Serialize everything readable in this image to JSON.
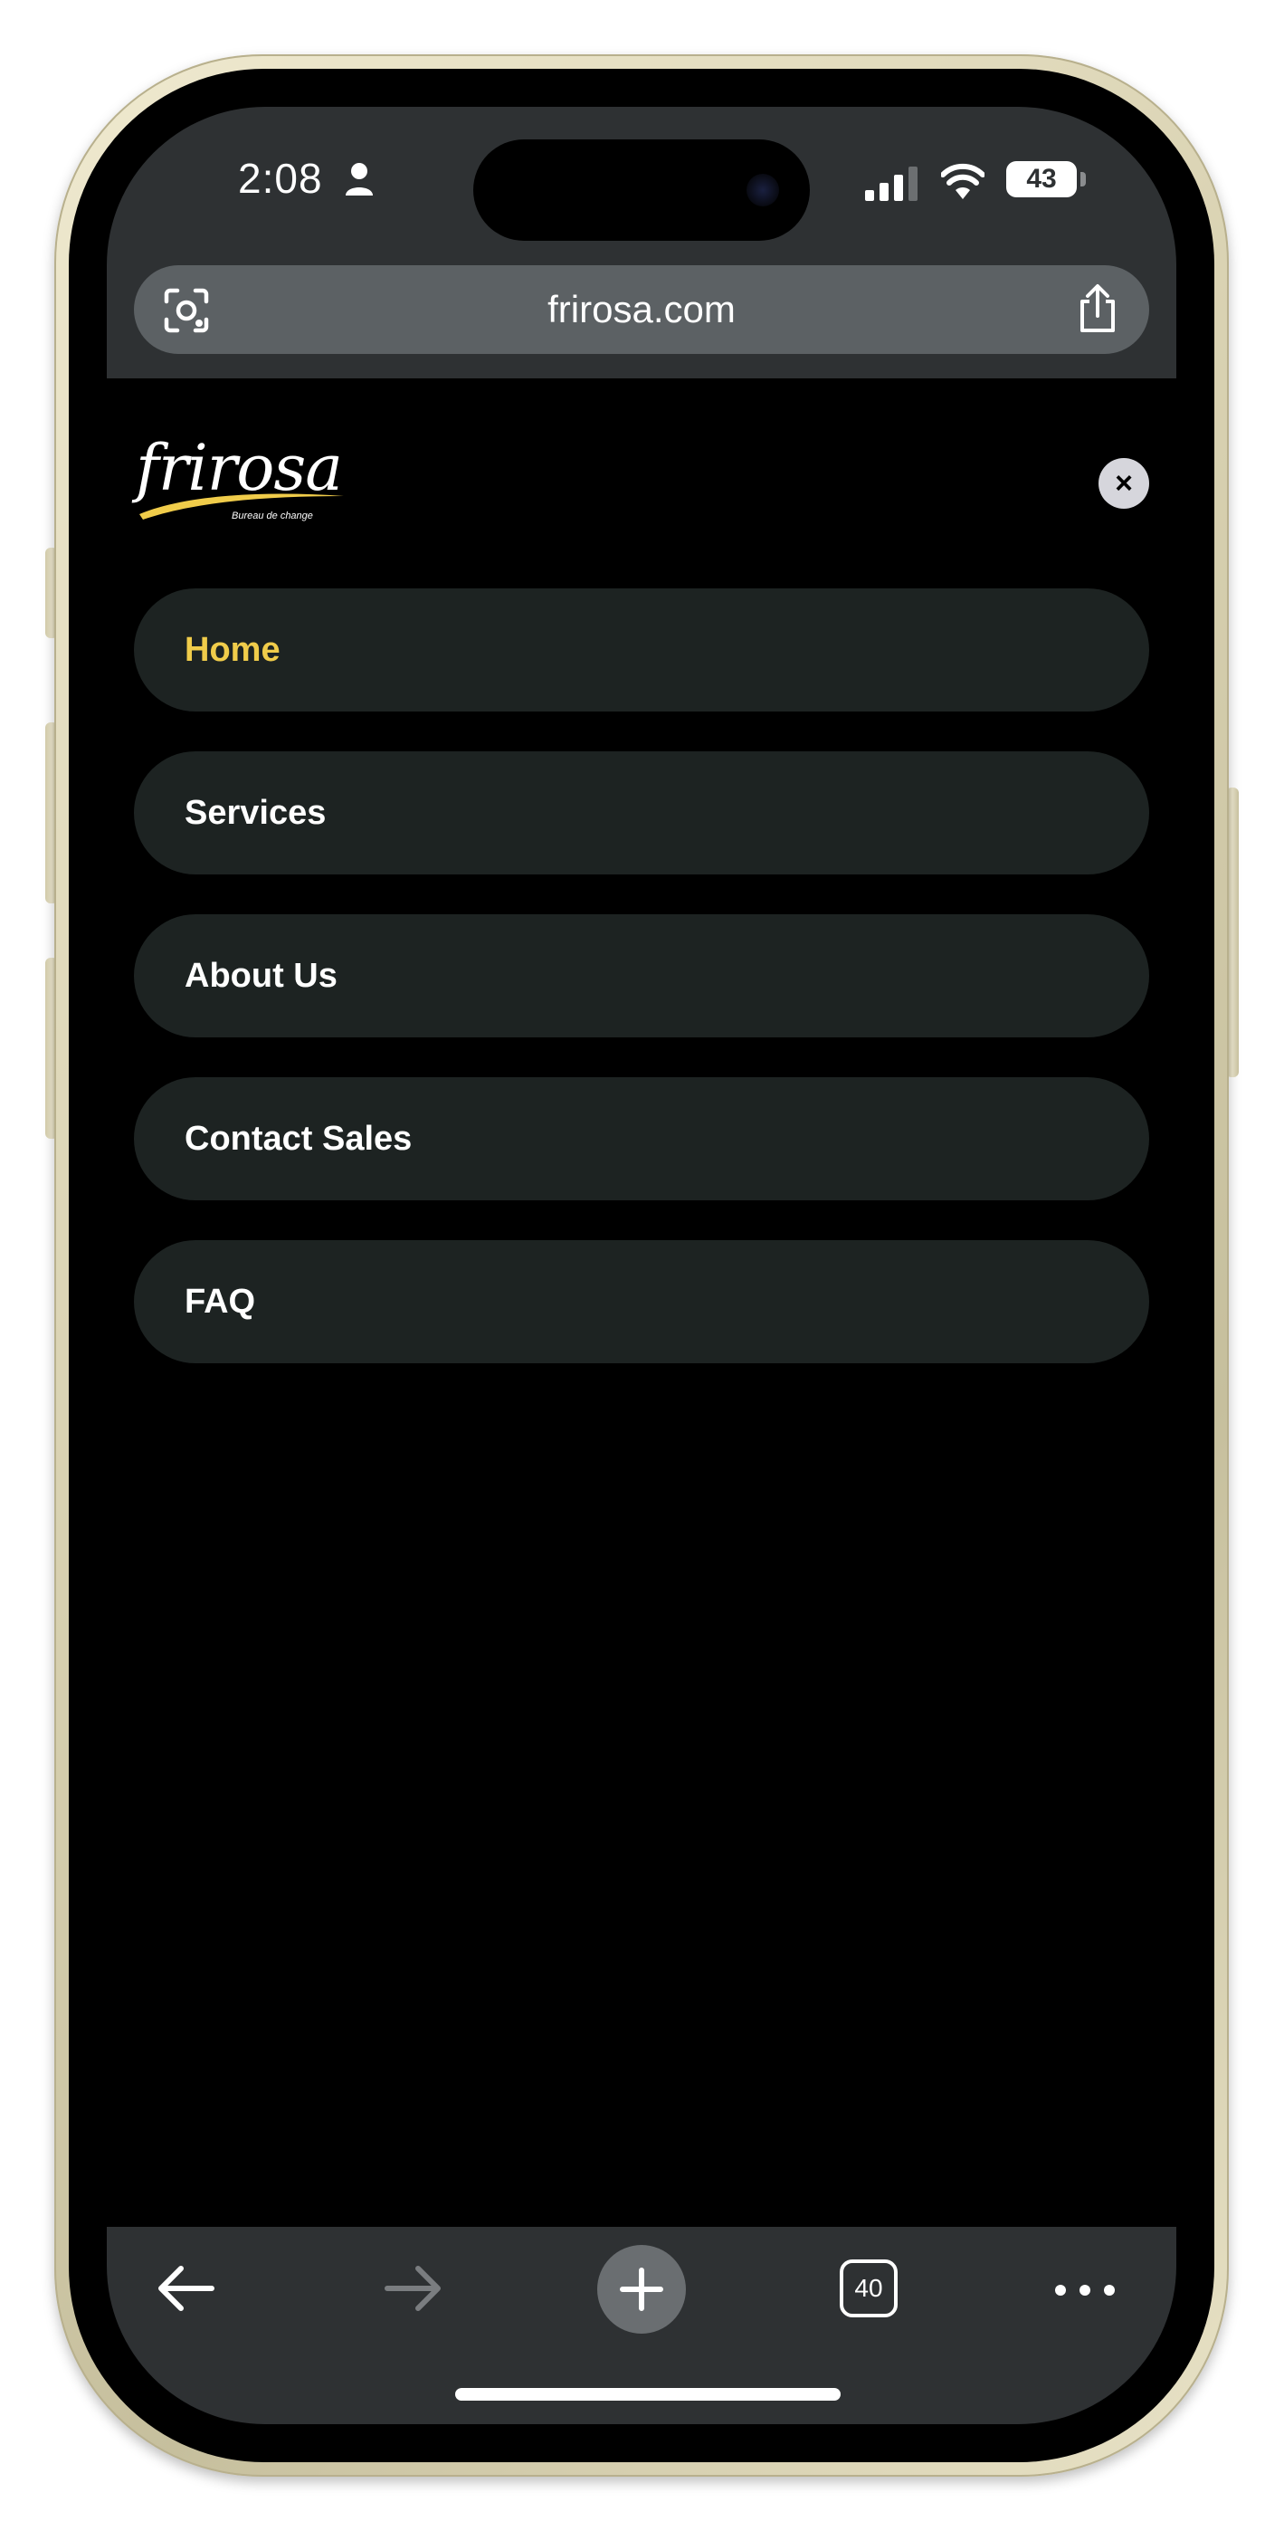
{
  "status_bar": {
    "time": "2:08",
    "battery": "43"
  },
  "browser": {
    "url": "frirosa.com",
    "tab_count": "40"
  },
  "logo": {
    "name": "frirosa",
    "tagline": "Bureau de change",
    "accent_color": "#f0cc4a"
  },
  "menu": {
    "close_label": "×",
    "items": [
      {
        "label": "Home",
        "active": true
      },
      {
        "label": "Services",
        "active": false
      },
      {
        "label": "About Us",
        "active": false
      },
      {
        "label": "Contact Sales",
        "active": false
      },
      {
        "label": "FAQ",
        "active": false
      }
    ]
  },
  "colors": {
    "active_item": "#f0cc4a",
    "item_background": "#1d2322",
    "browser_chrome": "#2e3133"
  }
}
